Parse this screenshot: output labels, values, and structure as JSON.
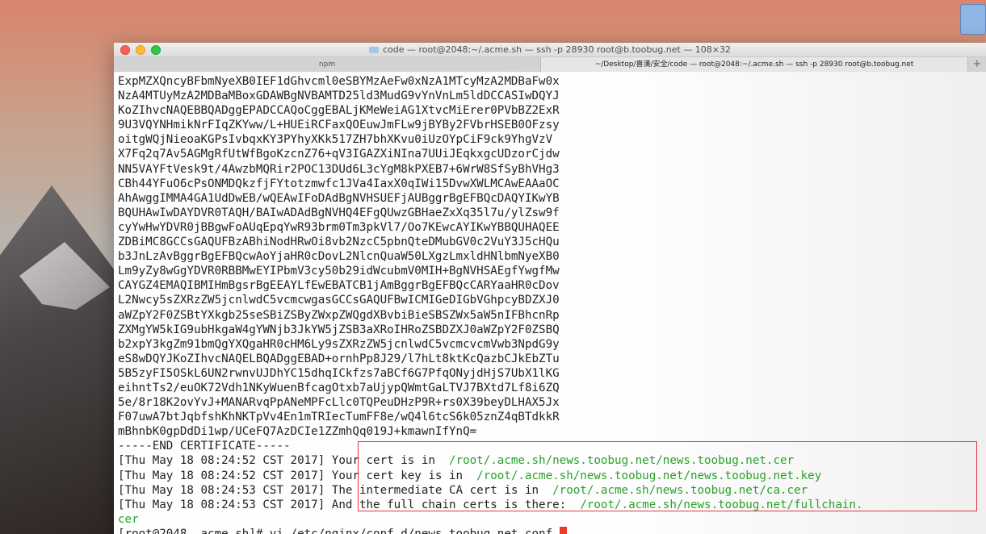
{
  "window": {
    "title": "code — root@2048:~/.acme.sh — ssh -p 28930 root@b.toobug.net — 108×32",
    "tabs": [
      "npm",
      "~/Desktop/喜漢/安全/code — root@2048:~/.acme.sh — ssh -p 28930 root@b.toobug.net"
    ],
    "add_tab": "+"
  },
  "terminal": {
    "cert_lines": [
      "ExpMZXQncyBFbmNyeXB0IEF1dGhvcml0eSBYMzAeFw0xNzA1MTcyMzA2MDBaFw0x",
      "NzA4MTUyMzA2MDBaMBoxGDAWBgNVBAMTD25ld3MudG9vYnVnLm5ldDCCASIwDQYJ",
      "KoZIhvcNAQEBBQADggEPADCCAQoCggEBALjKMeWeiAG1XtvcMiErer0PVbBZ2ExR",
      "9U3VQYNHmikNrFIqZKYww/L+HUEiRCFaxQOEuwJmFLw9jBYBy2FVbrHSEB0OFzsy",
      "oitgWQjNieoaKGPsIvbqxKY3PYhyXKk517ZH7bhXKvu0iUzOYpCiF9ck9YhgVzV",
      "X7Fq2q7Av5AGMgRfUtWfBgoKzcnZ76+qV3IGAZXiNIna7UUiJEqkxgcUDzorCjdw",
      "NN5VAYFtVesk9t/4AwzbMQRir2POC13DUd6L3cYgM8kPXEB7+6WrW8SfSyBhVHg3",
      "CBh44YFuO6cPsONMDQkzfjFYtotzmwfc1JVa4IaxX0qIWi15DvwXWLMCAwEAAaOC",
      "AhAwggIMMA4GA1UdDwEB/wQEAwIFoDAdBgNVHSUEFjAUBggrBgEFBQcDAQYIKwYB",
      "BQUHAwIwDAYDVR0TAQH/BAIwADAdBgNVHQ4EFgQUwzGBHaeZxXq35l7u/ylZsw9f",
      "cyYwHwYDVR0jBBgwFoAUqEpqYwR93brm0Tm3pkVl7/Oo7KEwcAYIKwYBBQUHAQEE",
      "ZDBiMC8GCCsGAQUFBzABhiNodHRwOi8vb2NzcC5pbnQteDMubGV0c2VuY3J5cHQu",
      "b3JnLzAvBggrBgEFBQcwAoYjaHR0cDovL2NlcnQuaW50LXgzLmxldHNlbmNyeXB0",
      "Lm9yZy8wGgYDVR0RBBMwEYIPbmV3cy50b29idWcubmV0MIH+BgNVHSAEgfYwgfMw",
      "CAYGZ4EMAQIBMIHmBgsrBgEEAYLfEwEBATCB1jAmBggrBgEFBQcCARYaaHR0cDov",
      "L2Nwcy5sZXRzZW5jcnlwdC5vcmcwgasGCCsGAQUFBwICMIGeDIGbVGhpcyBDZXJ0",
      "aWZpY2F0ZSBtYXkgb25seSBiZSByZWxpZWQgdXBvbiBieSBSZWx5aW5nIFBhcnRp",
      "ZXMgYW5kIG9ubHkgaW4gYWNjb3JkYW5jZSB3aXRoIHRoZSBDZXJ0aWZpY2F0ZSBQ",
      "b2xpY3kgZm91bmQgYXQgaHR0cHM6Ly9sZXRzZW5jcnlwdC5vcmcvcmVwb3NpdG9y",
      "eS8wDQYJKoZIhvcNAQELBQADggEBAD+ornhPp8J29/l7hLt8ktKcQazbCJkEbZTu",
      "5B5zyFI5OSkL6UN2rwnvUJDhYC15dhqICkfzs7aBCf6G7PfqONyjdHjS7UbX1lKG",
      "eihntTs2/euOK72Vdh1NKyWuenBfcagOtxb7aUjypQWmtGaLTVJ7BXtd7Lf8i6ZQ",
      "5e/8r18K2ovYvJ+MANARvqPpANeMPFcLlc0TQPeuDHzP9R+rs0X39beyDLHAX5Jx",
      "F07uwA7btJqbfshKhNKTpVv4En1mTRIecTumFF8e/wQ4l6tcS6k05znZ4qBTdkkR",
      "mBhnbK0gpDdDi1wp/UCeFQ7AzDCIe1ZZmhQq019J+kmawnIfYnQ=",
      "-----END CERTIFICATE-----"
    ],
    "status_lines": [
      {
        "timestamp": "[Thu May 18 08:24:52 CST 2017]",
        "message": "Your cert is in  ",
        "path": "/root/.acme.sh/news.toobug.net/news.toobug.net.cer"
      },
      {
        "timestamp": "[Thu May 18 08:24:52 CST 2017]",
        "message": "Your cert key is in  ",
        "path": "/root/.acme.sh/news.toobug.net/news.toobug.net.key"
      },
      {
        "timestamp": "[Thu May 18 08:24:53 CST 2017]",
        "message": "The intermediate CA cert is in  ",
        "path": "/root/.acme.sh/news.toobug.net/ca.cer"
      },
      {
        "timestamp": "[Thu May 18 08:24:53 CST 2017]",
        "message": "And the full chain certs is there:  ",
        "path": "/root/.acme.sh/news.toobug.net/fullchain."
      }
    ],
    "wrapped_tail": "cer",
    "prompt": "[root@2048 .acme.sh]# vi /etc/nginx/conf.d/news.toobug.net.conf "
  },
  "colors": {
    "path_green": "#2aa02a",
    "highlight_red": "#e0393e",
    "cursor": "#ec3a2a"
  }
}
